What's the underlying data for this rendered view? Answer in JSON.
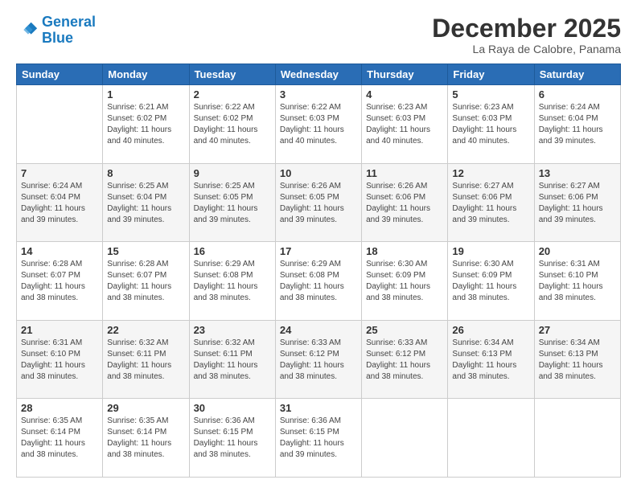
{
  "logo": {
    "line1": "General",
    "line2": "Blue"
  },
  "header": {
    "month_year": "December 2025",
    "location": "La Raya de Calobre, Panama"
  },
  "days_of_week": [
    "Sunday",
    "Monday",
    "Tuesday",
    "Wednesday",
    "Thursday",
    "Friday",
    "Saturday"
  ],
  "weeks": [
    [
      {
        "day": "",
        "sunrise": "",
        "sunset": "",
        "daylight": ""
      },
      {
        "day": "1",
        "sunrise": "Sunrise: 6:21 AM",
        "sunset": "Sunset: 6:02 PM",
        "daylight": "Daylight: 11 hours and 40 minutes."
      },
      {
        "day": "2",
        "sunrise": "Sunrise: 6:22 AM",
        "sunset": "Sunset: 6:02 PM",
        "daylight": "Daylight: 11 hours and 40 minutes."
      },
      {
        "day": "3",
        "sunrise": "Sunrise: 6:22 AM",
        "sunset": "Sunset: 6:03 PM",
        "daylight": "Daylight: 11 hours and 40 minutes."
      },
      {
        "day": "4",
        "sunrise": "Sunrise: 6:23 AM",
        "sunset": "Sunset: 6:03 PM",
        "daylight": "Daylight: 11 hours and 40 minutes."
      },
      {
        "day": "5",
        "sunrise": "Sunrise: 6:23 AM",
        "sunset": "Sunset: 6:03 PM",
        "daylight": "Daylight: 11 hours and 40 minutes."
      },
      {
        "day": "6",
        "sunrise": "Sunrise: 6:24 AM",
        "sunset": "Sunset: 6:04 PM",
        "daylight": "Daylight: 11 hours and 39 minutes."
      }
    ],
    [
      {
        "day": "7",
        "sunrise": "Sunrise: 6:24 AM",
        "sunset": "Sunset: 6:04 PM",
        "daylight": "Daylight: 11 hours and 39 minutes."
      },
      {
        "day": "8",
        "sunrise": "Sunrise: 6:25 AM",
        "sunset": "Sunset: 6:04 PM",
        "daylight": "Daylight: 11 hours and 39 minutes."
      },
      {
        "day": "9",
        "sunrise": "Sunrise: 6:25 AM",
        "sunset": "Sunset: 6:05 PM",
        "daylight": "Daylight: 11 hours and 39 minutes."
      },
      {
        "day": "10",
        "sunrise": "Sunrise: 6:26 AM",
        "sunset": "Sunset: 6:05 PM",
        "daylight": "Daylight: 11 hours and 39 minutes."
      },
      {
        "day": "11",
        "sunrise": "Sunrise: 6:26 AM",
        "sunset": "Sunset: 6:06 PM",
        "daylight": "Daylight: 11 hours and 39 minutes."
      },
      {
        "day": "12",
        "sunrise": "Sunrise: 6:27 AM",
        "sunset": "Sunset: 6:06 PM",
        "daylight": "Daylight: 11 hours and 39 minutes."
      },
      {
        "day": "13",
        "sunrise": "Sunrise: 6:27 AM",
        "sunset": "Sunset: 6:06 PM",
        "daylight": "Daylight: 11 hours and 39 minutes."
      }
    ],
    [
      {
        "day": "14",
        "sunrise": "Sunrise: 6:28 AM",
        "sunset": "Sunset: 6:07 PM",
        "daylight": "Daylight: 11 hours and 38 minutes."
      },
      {
        "day": "15",
        "sunrise": "Sunrise: 6:28 AM",
        "sunset": "Sunset: 6:07 PM",
        "daylight": "Daylight: 11 hours and 38 minutes."
      },
      {
        "day": "16",
        "sunrise": "Sunrise: 6:29 AM",
        "sunset": "Sunset: 6:08 PM",
        "daylight": "Daylight: 11 hours and 38 minutes."
      },
      {
        "day": "17",
        "sunrise": "Sunrise: 6:29 AM",
        "sunset": "Sunset: 6:08 PM",
        "daylight": "Daylight: 11 hours and 38 minutes."
      },
      {
        "day": "18",
        "sunrise": "Sunrise: 6:30 AM",
        "sunset": "Sunset: 6:09 PM",
        "daylight": "Daylight: 11 hours and 38 minutes."
      },
      {
        "day": "19",
        "sunrise": "Sunrise: 6:30 AM",
        "sunset": "Sunset: 6:09 PM",
        "daylight": "Daylight: 11 hours and 38 minutes."
      },
      {
        "day": "20",
        "sunrise": "Sunrise: 6:31 AM",
        "sunset": "Sunset: 6:10 PM",
        "daylight": "Daylight: 11 hours and 38 minutes."
      }
    ],
    [
      {
        "day": "21",
        "sunrise": "Sunrise: 6:31 AM",
        "sunset": "Sunset: 6:10 PM",
        "daylight": "Daylight: 11 hours and 38 minutes."
      },
      {
        "day": "22",
        "sunrise": "Sunrise: 6:32 AM",
        "sunset": "Sunset: 6:11 PM",
        "daylight": "Daylight: 11 hours and 38 minutes."
      },
      {
        "day": "23",
        "sunrise": "Sunrise: 6:32 AM",
        "sunset": "Sunset: 6:11 PM",
        "daylight": "Daylight: 11 hours and 38 minutes."
      },
      {
        "day": "24",
        "sunrise": "Sunrise: 6:33 AM",
        "sunset": "Sunset: 6:12 PM",
        "daylight": "Daylight: 11 hours and 38 minutes."
      },
      {
        "day": "25",
        "sunrise": "Sunrise: 6:33 AM",
        "sunset": "Sunset: 6:12 PM",
        "daylight": "Daylight: 11 hours and 38 minutes."
      },
      {
        "day": "26",
        "sunrise": "Sunrise: 6:34 AM",
        "sunset": "Sunset: 6:13 PM",
        "daylight": "Daylight: 11 hours and 38 minutes."
      },
      {
        "day": "27",
        "sunrise": "Sunrise: 6:34 AM",
        "sunset": "Sunset: 6:13 PM",
        "daylight": "Daylight: 11 hours and 38 minutes."
      }
    ],
    [
      {
        "day": "28",
        "sunrise": "Sunrise: 6:35 AM",
        "sunset": "Sunset: 6:14 PM",
        "daylight": "Daylight: 11 hours and 38 minutes."
      },
      {
        "day": "29",
        "sunrise": "Sunrise: 6:35 AM",
        "sunset": "Sunset: 6:14 PM",
        "daylight": "Daylight: 11 hours and 38 minutes."
      },
      {
        "day": "30",
        "sunrise": "Sunrise: 6:36 AM",
        "sunset": "Sunset: 6:15 PM",
        "daylight": "Daylight: 11 hours and 38 minutes."
      },
      {
        "day": "31",
        "sunrise": "Sunrise: 6:36 AM",
        "sunset": "Sunset: 6:15 PM",
        "daylight": "Daylight: 11 hours and 39 minutes."
      },
      {
        "day": "",
        "sunrise": "",
        "sunset": "",
        "daylight": ""
      },
      {
        "day": "",
        "sunrise": "",
        "sunset": "",
        "daylight": ""
      },
      {
        "day": "",
        "sunrise": "",
        "sunset": "",
        "daylight": ""
      }
    ]
  ]
}
